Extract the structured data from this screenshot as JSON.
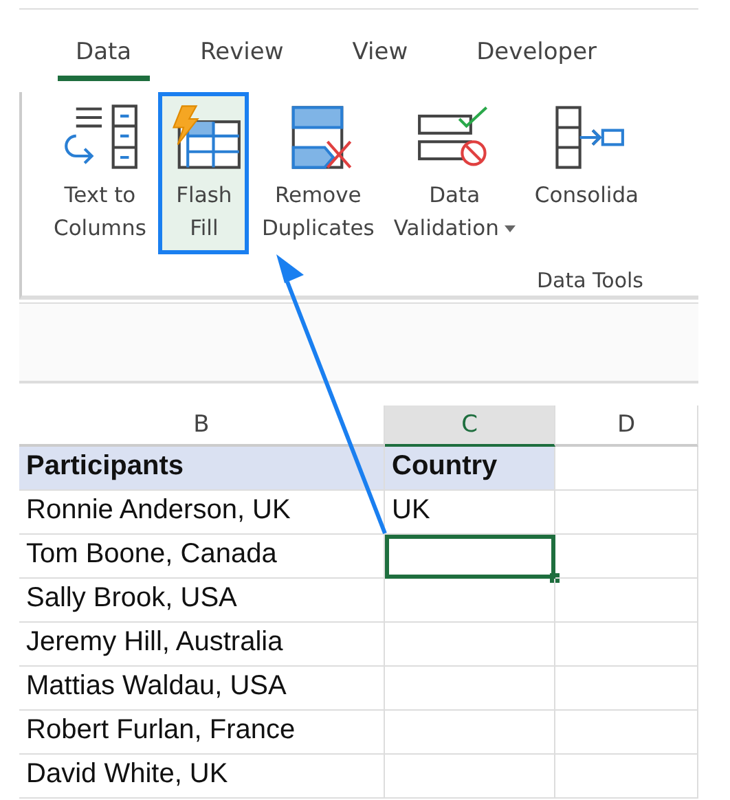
{
  "tabs": [
    {
      "label": "Data",
      "selected": true
    },
    {
      "label": "Review",
      "selected": false
    },
    {
      "label": "View",
      "selected": false
    },
    {
      "label": "Developer",
      "selected": false
    }
  ],
  "ribbon": {
    "group_label": "Data Tools",
    "buttons": [
      {
        "kind": "text-to-columns",
        "lines": [
          "Text to",
          "Columns"
        ],
        "highlighted": false,
        "dropdown": false
      },
      {
        "kind": "flash-fill",
        "lines": [
          "Flash",
          "Fill"
        ],
        "highlighted": true,
        "dropdown": false
      },
      {
        "kind": "remove-duplicates",
        "lines": [
          "Remove",
          "Duplicates"
        ],
        "highlighted": false,
        "dropdown": false
      },
      {
        "kind": "data-validation",
        "lines": [
          "Data",
          "Validation"
        ],
        "highlighted": false,
        "dropdown": true
      },
      {
        "kind": "consolidate",
        "lines": [
          "Consolida"
        ],
        "highlighted": false,
        "dropdown": false
      }
    ]
  },
  "grid": {
    "columns": [
      {
        "label": "B",
        "selected": false
      },
      {
        "label": "C",
        "selected": true
      },
      {
        "label": "D",
        "selected": false
      }
    ],
    "rows": [
      {
        "kind": "header",
        "b": "Participants",
        "c": "Country"
      },
      {
        "kind": "data",
        "b": "Ronnie Anderson, UK",
        "c": "UK",
        "selected": false
      },
      {
        "kind": "data",
        "b": "Tom Boone, Canada",
        "selected": true
      },
      {
        "kind": "data",
        "b": "Sally Brook, USA",
        "selected": false
      },
      {
        "kind": "data",
        "b": "Jeremy Hill, Australia",
        "selected": false
      },
      {
        "kind": "data",
        "b": "Mattias Waldau, USA",
        "selected": false
      },
      {
        "kind": "data",
        "b": "Robert Furlan, France",
        "selected": false
      },
      {
        "kind": "data",
        "b": "David White, UK",
        "selected": false
      }
    ]
  }
}
